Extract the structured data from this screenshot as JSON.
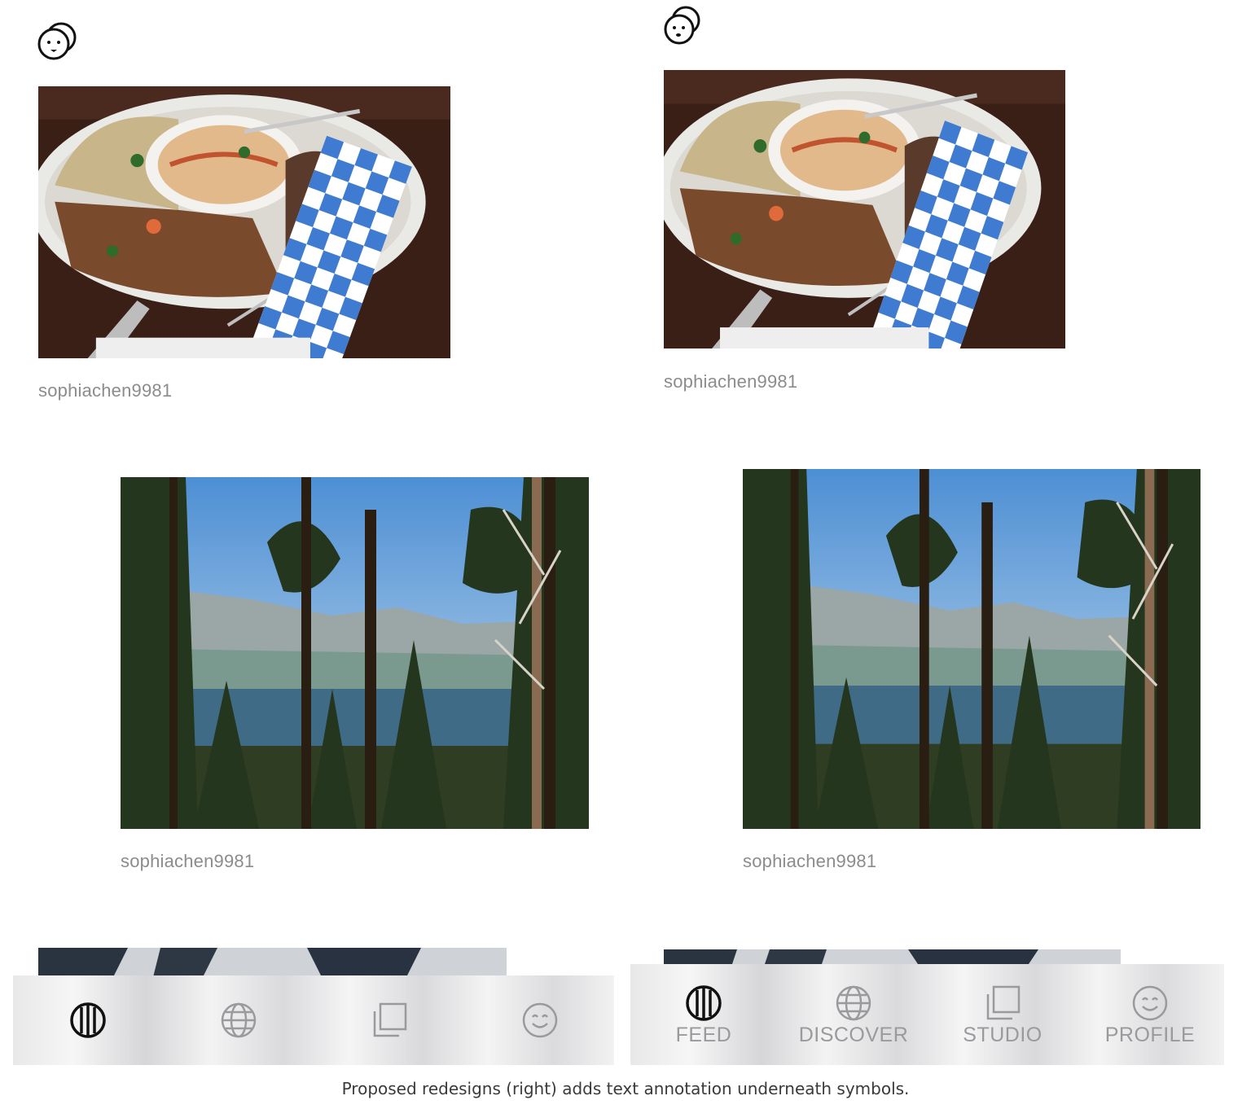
{
  "left_screen": {
    "posts": [
      {
        "username": "sophiachen9981",
        "image": "food-platter-photo"
      },
      {
        "username": "sophiachen9981",
        "image": "pine-forest-lake-photo"
      }
    ],
    "tabs": [
      {
        "icon": "feed-icon",
        "active": true
      },
      {
        "icon": "globe-icon",
        "active": false
      },
      {
        "icon": "studio-icon",
        "active": false
      },
      {
        "icon": "smiley-icon",
        "active": false
      }
    ]
  },
  "right_screen": {
    "posts": [
      {
        "username": "sophiachen9981",
        "image": "food-platter-photo"
      },
      {
        "username": "sophiachen9981",
        "image": "pine-forest-lake-photo"
      }
    ],
    "tabs": [
      {
        "icon": "feed-icon",
        "label": "FEED",
        "active": true
      },
      {
        "icon": "globe-icon",
        "label": "DISCOVER",
        "active": false
      },
      {
        "icon": "studio-icon",
        "label": "STUDIO",
        "active": false
      },
      {
        "icon": "smiley-icon",
        "label": "PROFILE",
        "active": false
      }
    ]
  },
  "caption": "Proposed redesigns (right) adds text annotation underneath symbols.",
  "colors": {
    "active_icon": "#111111",
    "inactive_icon": "#9a9a9c",
    "username": "#8c8c8c"
  }
}
